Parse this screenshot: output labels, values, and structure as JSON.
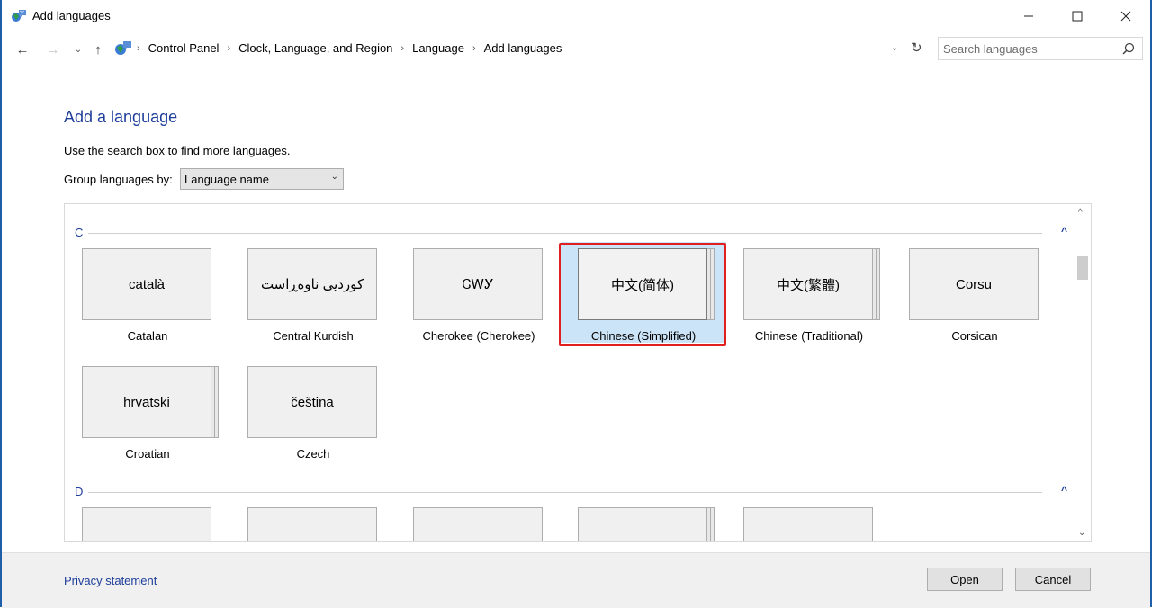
{
  "window": {
    "title": "Add languages"
  },
  "address": {
    "breadcrumbs": [
      "Control Panel",
      "Clock, Language, and Region",
      "Language",
      "Add languages"
    ]
  },
  "search": {
    "placeholder": "Search languages",
    "value": ""
  },
  "main": {
    "heading": "Add a language",
    "instruction": "Use the search box to find more languages.",
    "group_label": "Group languages by:",
    "group_value": "Language name"
  },
  "sections": [
    {
      "letter": "C",
      "tiles": [
        {
          "native": "català",
          "name": "Catalan",
          "stacked": false,
          "selected": false
        },
        {
          "native": "کوردیی ناوەڕاست",
          "name": "Central Kurdish",
          "stacked": false,
          "selected": false
        },
        {
          "native": "ᏣᎳᎩ",
          "name": "Cherokee (Cherokee)",
          "stacked": false,
          "selected": false
        },
        {
          "native": "中文(简体)",
          "name": "Chinese (Simplified)",
          "stacked": true,
          "selected": true
        },
        {
          "native": "中文(繁體)",
          "name": "Chinese (Traditional)",
          "stacked": true,
          "selected": false
        },
        {
          "native": "Corsu",
          "name": "Corsican",
          "stacked": false,
          "selected": false
        },
        {
          "native": "hrvatski",
          "name": "Croatian",
          "stacked": true,
          "selected": false
        },
        {
          "native": "čeština",
          "name": "Czech",
          "stacked": false,
          "selected": false
        }
      ]
    },
    {
      "letter": "D"
    }
  ],
  "footer": {
    "privacy": "Privacy statement",
    "open": "Open",
    "cancel": "Cancel"
  },
  "colors": {
    "accent": "#1e3e9a",
    "selection": "#cce4f7",
    "highlight_frame": "#e02020"
  }
}
